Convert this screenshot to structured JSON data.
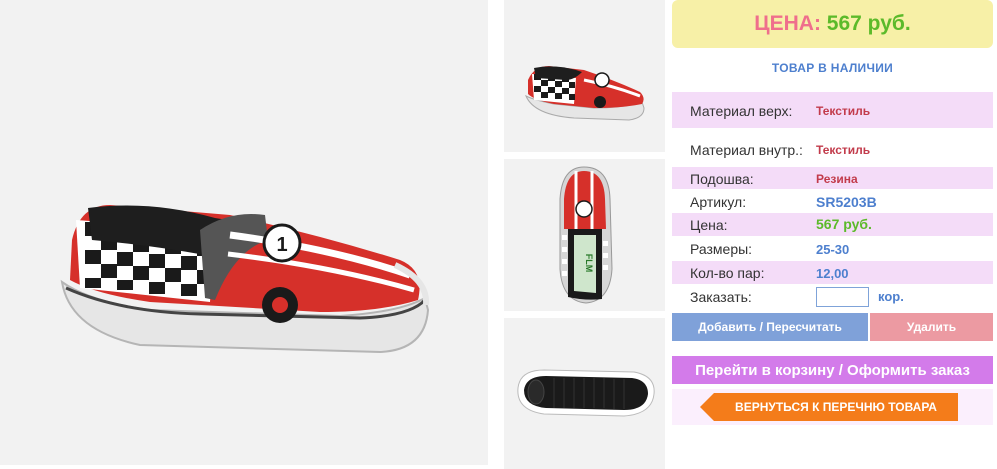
{
  "price_box": {
    "label": "ЦЕНА:",
    "value": "567 руб."
  },
  "stock_status": "ТОВАР В НАЛИЧИИ",
  "specs": [
    {
      "label": "Материал верх:",
      "value": "Текстиль"
    },
    {
      "label": "Материал внутр.:",
      "value": "Текстиль"
    },
    {
      "label": "Подошва:",
      "value": "Резина"
    },
    {
      "label": "Артикул:",
      "value": "SR5203B"
    },
    {
      "label": "Цена:",
      "value": "567 руб."
    },
    {
      "label": "Размеры:",
      "value": "25-30"
    },
    {
      "label": "Кол-во пар:",
      "value": "12,00"
    }
  ],
  "order": {
    "label": "Заказать:",
    "input_value": "",
    "unit": "кор."
  },
  "buttons": {
    "add": "Добавить / Пересчитать",
    "delete": "Удалить",
    "cart": "Перейти в корзину / Оформить заказ",
    "back": "ВЕРНУТЬСЯ К ПЕРЕЧНЮ ТОВАРА"
  },
  "colors": {
    "price_bg": "#f7f0a7",
    "price_label": "#ef6f8c",
    "price_value": "#5cba2a",
    "accent_blue": "#4d7fce",
    "row_pink": "#f4dcf8",
    "button_add": "#7fa1d9",
    "button_delete": "#ec9aa2",
    "button_cart": "#d37bea",
    "button_back": "#f47c1a"
  }
}
